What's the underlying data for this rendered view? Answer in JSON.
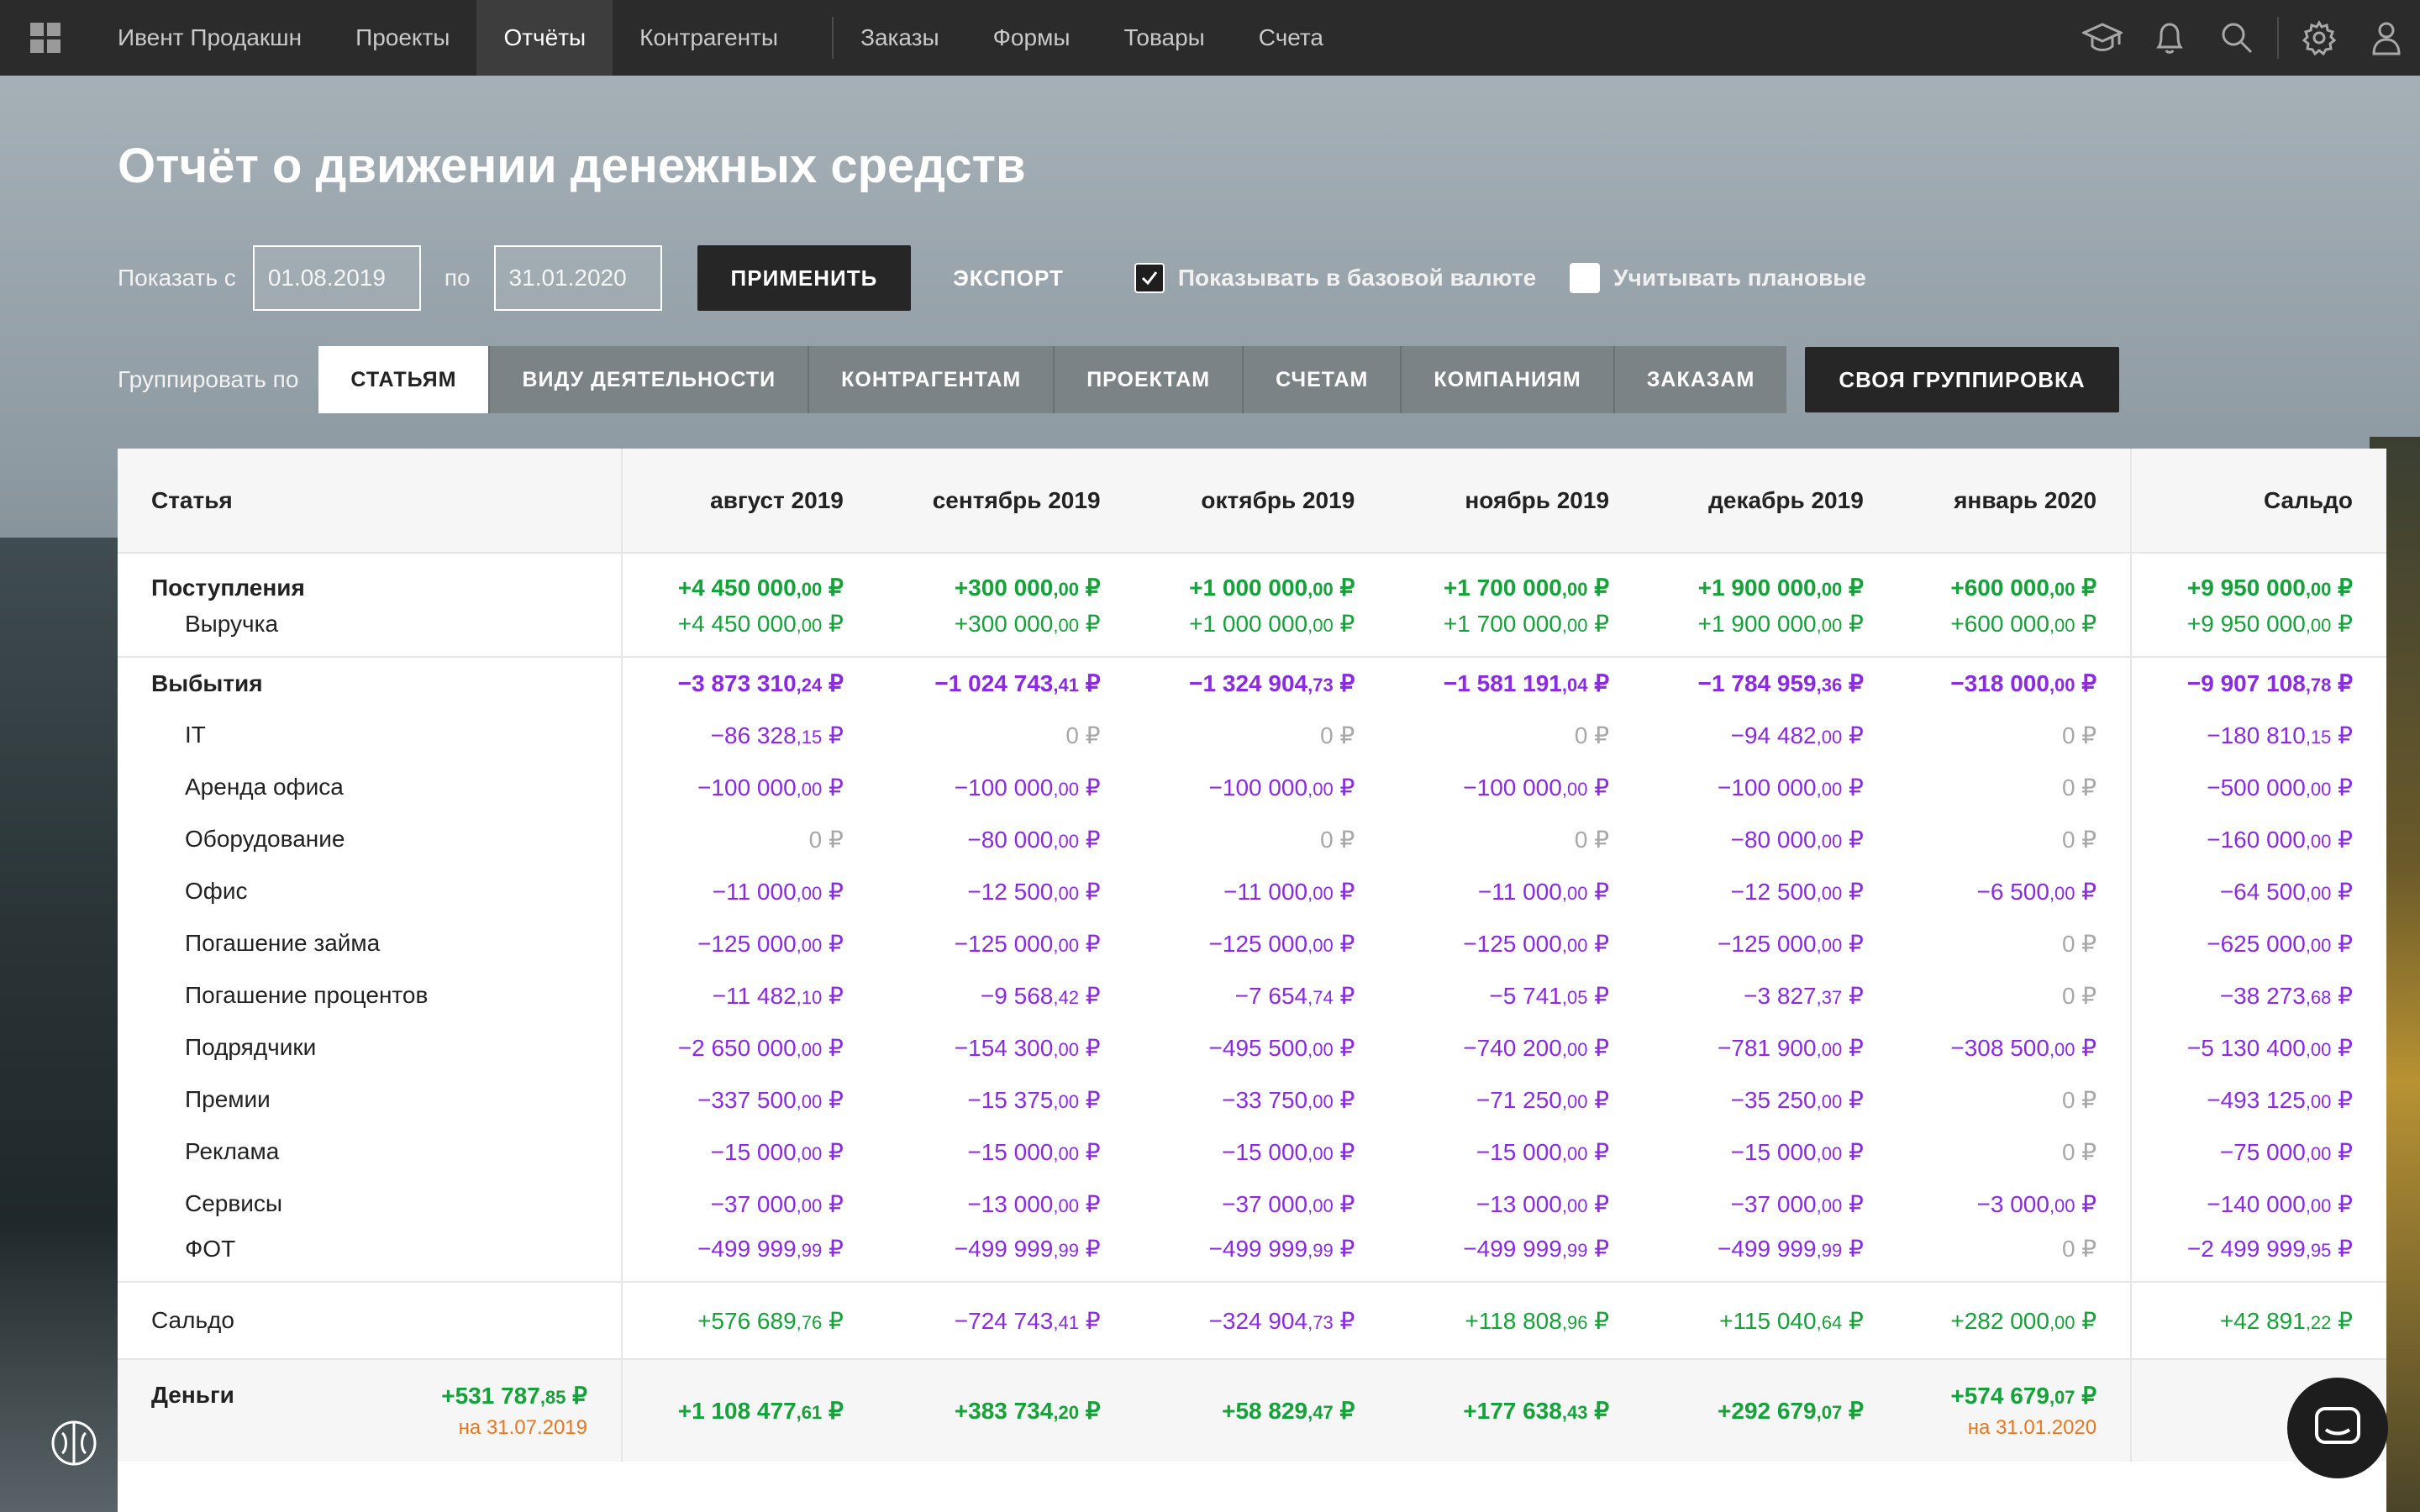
{
  "topbar": {
    "items": [
      {
        "label": "Ивент Продакшн",
        "active": false
      },
      {
        "label": "Проекты",
        "active": false
      },
      {
        "label": "Отчёты",
        "active": true
      },
      {
        "label": "Контрагенты",
        "active": false
      },
      {
        "label": "Заказы",
        "active": false
      },
      {
        "label": "Формы",
        "active": false
      },
      {
        "label": "Товары",
        "active": false
      },
      {
        "label": "Счета",
        "active": false
      }
    ],
    "icons": [
      "graduation-cap-icon",
      "bell-icon",
      "search-icon",
      "gear-icon",
      "user-icon"
    ]
  },
  "page": {
    "title": "Отчёт о движении денежных средств"
  },
  "filters": {
    "from_label": "Показать с",
    "from_value": "01.08.2019",
    "to_label": "по",
    "to_value": "31.01.2020",
    "apply": "ПРИМЕНИТЬ",
    "export": "ЭКСПОРТ",
    "base_currency": {
      "label": "Показывать в базовой валюте",
      "checked": true
    },
    "planned": {
      "label": "Учитывать плановые",
      "checked": false
    }
  },
  "grouping": {
    "label": "Группировать по",
    "options": [
      "СТАТЬЯМ",
      "ВИДУ ДЕЯТЕЛЬНОСТИ",
      "КОНТРАГЕНТАМ",
      "ПРОЕКТАМ",
      "СЧЕТАМ",
      "КОМПАНИЯМ",
      "ЗАКАЗАМ"
    ],
    "active": "СТАТЬЯМ",
    "custom": "СВОЯ ГРУППИРОВКА"
  },
  "table": {
    "headers": [
      "Статья",
      "август 2019",
      "сентябрь 2019",
      "октябрь 2019",
      "ноябрь 2019",
      "декабрь 2019",
      "январь 2020",
      "Сальдо"
    ],
    "income": {
      "label": "Поступления",
      "values": [
        {
          "main": "+4 450 000",
          "kop": ",00",
          "cur": " ₽"
        },
        {
          "main": "+300 000",
          "kop": ",00",
          "cur": " ₽"
        },
        {
          "main": "+1 000 000",
          "kop": ",00",
          "cur": " ₽"
        },
        {
          "main": "+1 700 000",
          "kop": ",00",
          "cur": " ₽"
        },
        {
          "main": "+1 900 000",
          "kop": ",00",
          "cur": " ₽"
        },
        {
          "main": "+600 000",
          "kop": ",00",
          "cur": " ₽"
        },
        {
          "main": "+9 950 000",
          "kop": ",00",
          "cur": " ₽"
        }
      ],
      "rows": [
        {
          "label": "Выручка",
          "values": [
            {
              "main": "+4 450 000",
              "kop": ",00",
              "cur": " ₽"
            },
            {
              "main": "+300 000",
              "kop": ",00",
              "cur": " ₽"
            },
            {
              "main": "+1 000 000",
              "kop": ",00",
              "cur": " ₽"
            },
            {
              "main": "+1 700 000",
              "kop": ",00",
              "cur": " ₽"
            },
            {
              "main": "+1 900 000",
              "kop": ",00",
              "cur": " ₽"
            },
            {
              "main": "+600 000",
              "kop": ",00",
              "cur": " ₽"
            },
            {
              "main": "+9 950 000",
              "kop": ",00",
              "cur": " ₽"
            }
          ]
        }
      ]
    },
    "outflow": {
      "label": "Выбытия",
      "values": [
        {
          "main": "−3 873 310",
          "kop": ",24",
          "cur": " ₽"
        },
        {
          "main": "−1 024 743",
          "kop": ",41",
          "cur": " ₽"
        },
        {
          "main": "−1 324 904",
          "kop": ",73",
          "cur": " ₽"
        },
        {
          "main": "−1 581 191",
          "kop": ",04",
          "cur": " ₽"
        },
        {
          "main": "−1 784 959",
          "kop": ",36",
          "cur": " ₽"
        },
        {
          "main": "−318 000",
          "kop": ",00",
          "cur": " ₽"
        },
        {
          "main": "−9 907 108",
          "kop": ",78",
          "cur": " ₽"
        }
      ],
      "rows": [
        {
          "label": "IT",
          "values": [
            {
              "main": "−86 328",
              "kop": ",15",
              "cur": " ₽"
            },
            {
              "main": "0",
              "kop": "",
              "cur": " ₽"
            },
            {
              "main": "0",
              "kop": "",
              "cur": " ₽"
            },
            {
              "main": "0",
              "kop": "",
              "cur": " ₽"
            },
            {
              "main": "−94 482",
              "kop": ",00",
              "cur": " ₽"
            },
            {
              "main": "0",
              "kop": "",
              "cur": " ₽"
            },
            {
              "main": "−180 810",
              "kop": ",15",
              "cur": " ₽"
            }
          ]
        },
        {
          "label": "Аренда офиса",
          "values": [
            {
              "main": "−100 000",
              "kop": ",00",
              "cur": " ₽"
            },
            {
              "main": "−100 000",
              "kop": ",00",
              "cur": " ₽"
            },
            {
              "main": "−100 000",
              "kop": ",00",
              "cur": " ₽"
            },
            {
              "main": "−100 000",
              "kop": ",00",
              "cur": " ₽"
            },
            {
              "main": "−100 000",
              "kop": ",00",
              "cur": " ₽"
            },
            {
              "main": "0",
              "kop": "",
              "cur": " ₽"
            },
            {
              "main": "−500 000",
              "kop": ",00",
              "cur": " ₽"
            }
          ]
        },
        {
          "label": "Оборудование",
          "values": [
            {
              "main": "0",
              "kop": "",
              "cur": " ₽"
            },
            {
              "main": "−80 000",
              "kop": ",00",
              "cur": " ₽"
            },
            {
              "main": "0",
              "kop": "",
              "cur": " ₽"
            },
            {
              "main": "0",
              "kop": "",
              "cur": " ₽"
            },
            {
              "main": "−80 000",
              "kop": ",00",
              "cur": " ₽"
            },
            {
              "main": "0",
              "kop": "",
              "cur": " ₽"
            },
            {
              "main": "−160 000",
              "kop": ",00",
              "cur": " ₽"
            }
          ]
        },
        {
          "label": "Офис",
          "values": [
            {
              "main": "−11 000",
              "kop": ",00",
              "cur": " ₽"
            },
            {
              "main": "−12 500",
              "kop": ",00",
              "cur": " ₽"
            },
            {
              "main": "−11 000",
              "kop": ",00",
              "cur": " ₽"
            },
            {
              "main": "−11 000",
              "kop": ",00",
              "cur": " ₽"
            },
            {
              "main": "−12 500",
              "kop": ",00",
              "cur": " ₽"
            },
            {
              "main": "−6 500",
              "kop": ",00",
              "cur": " ₽"
            },
            {
              "main": "−64 500",
              "kop": ",00",
              "cur": " ₽"
            }
          ]
        },
        {
          "label": "Погашение займа",
          "values": [
            {
              "main": "−125 000",
              "kop": ",00",
              "cur": " ₽"
            },
            {
              "main": "−125 000",
              "kop": ",00",
              "cur": " ₽"
            },
            {
              "main": "−125 000",
              "kop": ",00",
              "cur": " ₽"
            },
            {
              "main": "−125 000",
              "kop": ",00",
              "cur": " ₽"
            },
            {
              "main": "−125 000",
              "kop": ",00",
              "cur": " ₽"
            },
            {
              "main": "0",
              "kop": "",
              "cur": " ₽"
            },
            {
              "main": "−625 000",
              "kop": ",00",
              "cur": " ₽"
            }
          ]
        },
        {
          "label": "Погашение процентов",
          "values": [
            {
              "main": "−11 482",
              "kop": ",10",
              "cur": " ₽"
            },
            {
              "main": "−9 568",
              "kop": ",42",
              "cur": " ₽"
            },
            {
              "main": "−7 654",
              "kop": ",74",
              "cur": " ₽"
            },
            {
              "main": "−5 741",
              "kop": ",05",
              "cur": " ₽"
            },
            {
              "main": "−3 827",
              "kop": ",37",
              "cur": " ₽"
            },
            {
              "main": "0",
              "kop": "",
              "cur": " ₽"
            },
            {
              "main": "−38 273",
              "kop": ",68",
              "cur": " ₽"
            }
          ]
        },
        {
          "label": "Подрядчики",
          "values": [
            {
              "main": "−2 650 000",
              "kop": ",00",
              "cur": " ₽"
            },
            {
              "main": "−154 300",
              "kop": ",00",
              "cur": " ₽"
            },
            {
              "main": "−495 500",
              "kop": ",00",
              "cur": " ₽"
            },
            {
              "main": "−740 200",
              "kop": ",00",
              "cur": " ₽"
            },
            {
              "main": "−781 900",
              "kop": ",00",
              "cur": " ₽"
            },
            {
              "main": "−308 500",
              "kop": ",00",
              "cur": " ₽"
            },
            {
              "main": "−5 130 400",
              "kop": ",00",
              "cur": " ₽"
            }
          ]
        },
        {
          "label": "Премии",
          "values": [
            {
              "main": "−337 500",
              "kop": ",00",
              "cur": " ₽"
            },
            {
              "main": "−15 375",
              "kop": ",00",
              "cur": " ₽"
            },
            {
              "main": "−33 750",
              "kop": ",00",
              "cur": " ₽"
            },
            {
              "main": "−71 250",
              "kop": ",00",
              "cur": " ₽"
            },
            {
              "main": "−35 250",
              "kop": ",00",
              "cur": " ₽"
            },
            {
              "main": "0",
              "kop": "",
              "cur": " ₽"
            },
            {
              "main": "−493 125",
              "kop": ",00",
              "cur": " ₽"
            }
          ]
        },
        {
          "label": "Реклама",
          "values": [
            {
              "main": "−15 000",
              "kop": ",00",
              "cur": " ₽"
            },
            {
              "main": "−15 000",
              "kop": ",00",
              "cur": " ₽"
            },
            {
              "main": "−15 000",
              "kop": ",00",
              "cur": " ₽"
            },
            {
              "main": "−15 000",
              "kop": ",00",
              "cur": " ₽"
            },
            {
              "main": "−15 000",
              "kop": ",00",
              "cur": " ₽"
            },
            {
              "main": "0",
              "kop": "",
              "cur": " ₽"
            },
            {
              "main": "−75 000",
              "kop": ",00",
              "cur": " ₽"
            }
          ]
        },
        {
          "label": "Сервисы",
          "values": [
            {
              "main": "−37 000",
              "kop": ",00",
              "cur": " ₽"
            },
            {
              "main": "−13 000",
              "kop": ",00",
              "cur": " ₽"
            },
            {
              "main": "−37 000",
              "kop": ",00",
              "cur": " ₽"
            },
            {
              "main": "−13 000",
              "kop": ",00",
              "cur": " ₽"
            },
            {
              "main": "−37 000",
              "kop": ",00",
              "cur": " ₽"
            },
            {
              "main": "−3 000",
              "kop": ",00",
              "cur": " ₽"
            },
            {
              "main": "−140 000",
              "kop": ",00",
              "cur": " ₽"
            }
          ]
        },
        {
          "label": "ФОТ",
          "values": [
            {
              "main": "−499 999",
              "kop": ",99",
              "cur": " ₽"
            },
            {
              "main": "−499 999",
              "kop": ",99",
              "cur": " ₽"
            },
            {
              "main": "−499 999",
              "kop": ",99",
              "cur": " ₽"
            },
            {
              "main": "−499 999",
              "kop": ",99",
              "cur": " ₽"
            },
            {
              "main": "−499 999",
              "kop": ",99",
              "cur": " ₽"
            },
            {
              "main": "0",
              "kop": "",
              "cur": " ₽"
            },
            {
              "main": "−2 499 999",
              "kop": ",95",
              "cur": " ₽"
            }
          ]
        }
      ]
    },
    "saldo": {
      "label": "Сальдо",
      "values": [
        {
          "main": "+576 689",
          "kop": ",76",
          "cur": " ₽"
        },
        {
          "main": "−724 743",
          "kop": ",41",
          "cur": " ₽"
        },
        {
          "main": "−324 904",
          "kop": ",73",
          "cur": " ₽"
        },
        {
          "main": "+118 808",
          "kop": ",96",
          "cur": " ₽"
        },
        {
          "main": "+115 040",
          "kop": ",64",
          "cur": " ₽"
        },
        {
          "main": "+282 000",
          "kop": ",00",
          "cur": " ₽"
        },
        {
          "main": "+42 891",
          "kop": ",22",
          "cur": " ₽"
        }
      ]
    },
    "money": {
      "label": "Деньги",
      "opening": {
        "main": "+531 787",
        "kop": ",85",
        "cur": " ₽",
        "date": "на 31.07.2019"
      },
      "values": [
        {
          "main": "+1 108 477",
          "kop": ",61",
          "cur": " ₽"
        },
        {
          "main": "+383 734",
          "kop": ",20",
          "cur": " ₽"
        },
        {
          "main": "+58 829",
          "kop": ",47",
          "cur": " ₽"
        },
        {
          "main": "+177 638",
          "kop": ",43",
          "cur": " ₽"
        },
        {
          "main": "+292 679",
          "kop": ",07",
          "cur": " ₽"
        },
        {
          "main": "+574 679",
          "kop": ",07",
          "cur": " ₽",
          "date": "на 31.01.2020"
        },
        {
          "main": "",
          "kop": "",
          "cur": ""
        }
      ]
    }
  },
  "colors": {
    "positive": "#16a13a",
    "negative": "#8a2be2",
    "zero": "#a8a8a8",
    "date_note": "#e8771f",
    "topbar": "#2b2b2b"
  }
}
